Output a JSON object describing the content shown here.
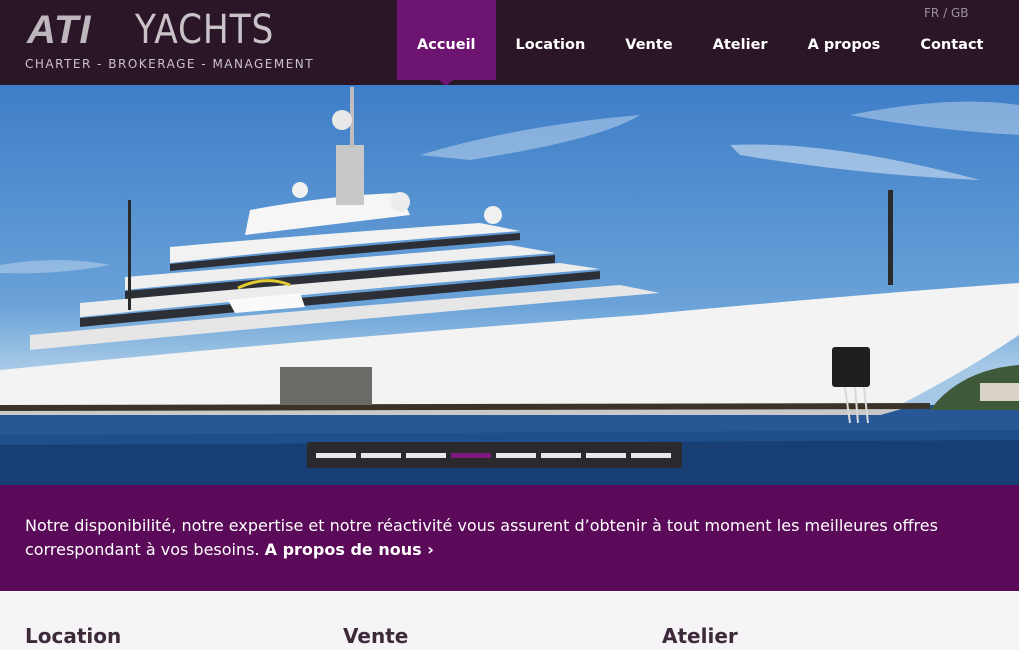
{
  "header": {
    "logo_mark": "ATI",
    "logo_name": "YACHTS",
    "logo_tagline": "CHARTER - BROKERAGE - MANAGEMENT",
    "lang_fr": "FR",
    "lang_sep": "/",
    "lang_gb": "GB"
  },
  "nav": {
    "items": [
      {
        "label": "Accueil",
        "active": true
      },
      {
        "label": "Location"
      },
      {
        "label": "Vente"
      },
      {
        "label": "Atelier"
      },
      {
        "label": "A propos"
      },
      {
        "label": "Contact"
      }
    ]
  },
  "hero": {
    "slider": {
      "count": 8,
      "active_index": 3
    }
  },
  "tagline": {
    "text": "Notre disponibilité, notre expertise et notre réactivité vous assurent d’obtenir à tout moment les meilleures offres correspondant à vos besoins. ",
    "link": "A propos de nous ›"
  },
  "sections": {
    "location": "Location",
    "vente": "Vente",
    "atelier": "Atelier"
  },
  "colors": {
    "header_bg": "#2b1628",
    "accent_purple": "#6d1470",
    "tagline_bg": "#5a0a59"
  }
}
